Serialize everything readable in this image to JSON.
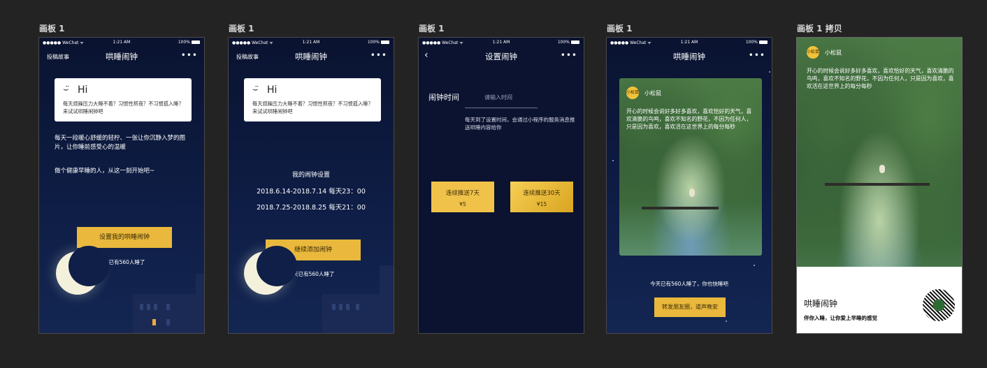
{
  "boards": [
    {
      "label": "画板 1"
    },
    {
      "label": "画板 1"
    },
    {
      "label": "画板 1"
    },
    {
      "label": "画板 1"
    },
    {
      "label": "画板 1 拷贝"
    }
  ],
  "statusbar": {
    "carrier": "●●●●● WeChat ᯤ",
    "time": "1:21 AM",
    "battery": "100%"
  },
  "nav": {
    "title": "哄睡闹钟",
    "left_link": "投稿故事",
    "more": "•••",
    "set_alarm_title": "设置闹钟"
  },
  "greeting": {
    "hi": "Hi",
    "smile": "◡̈",
    "text": "每天烦躁压力大睡不着？习惯性熬夜？不习惯孤入睡？来试试哄睡闹钟吧",
    "text2": "每天烦躁压力大睡不着？习惯性熬夜？不习惯孤入睡？来试试哄睡闹钟吧"
  },
  "intro": {
    "line1": "每天一段暖心舒缓的轻柠、一张让你沉静入梦的图片，让你睡前感受心的温暖",
    "line2": "做个健康早睡的人，从这一刻开始吧~"
  },
  "buttons": {
    "set_alarm": "设置我的哄睡闹钟",
    "continue_add": "继续添加闹钟",
    "share": "转发朋友圈，道声晚安"
  },
  "count_text": "今天已有560人睡了",
  "schedule": {
    "title": "我的闹钟设置",
    "items": [
      "2018.6.14-2018.7.14  每天23：00",
      "2018.7.25-2018.8.25  每天21：00"
    ]
  },
  "alarm_form": {
    "label": "闹钟时间",
    "placeholder": "请输入时间",
    "note": "每天到了设置时间，会通过小程序的服务消息推送哄睡内容给你",
    "plans": [
      {
        "title": "连续推送7天",
        "price": "¥5"
      },
      {
        "title": "连续推送30天",
        "price": "¥15"
      }
    ]
  },
  "story": {
    "user": "小松鼠",
    "avatar_text": "小松鼠",
    "text": "开心的时候会说好多好多喜欢，喜欢恰好的天气，喜欢清脆的鸟鸣，喜欢不知名的野花，不因为任何人，只是因为喜欢，喜欢活在这世界上的每分每秒",
    "sleep_text": "今天已有560人睡了，你也快睡吧"
  },
  "share_card": {
    "title": "哄睡闹钟",
    "slogan": "伴你入睡，让你爱上早睡的感觉"
  },
  "colors": {
    "gold": "#e9b83c",
    "night": "#0e1d45",
    "canvas": "#232323"
  }
}
